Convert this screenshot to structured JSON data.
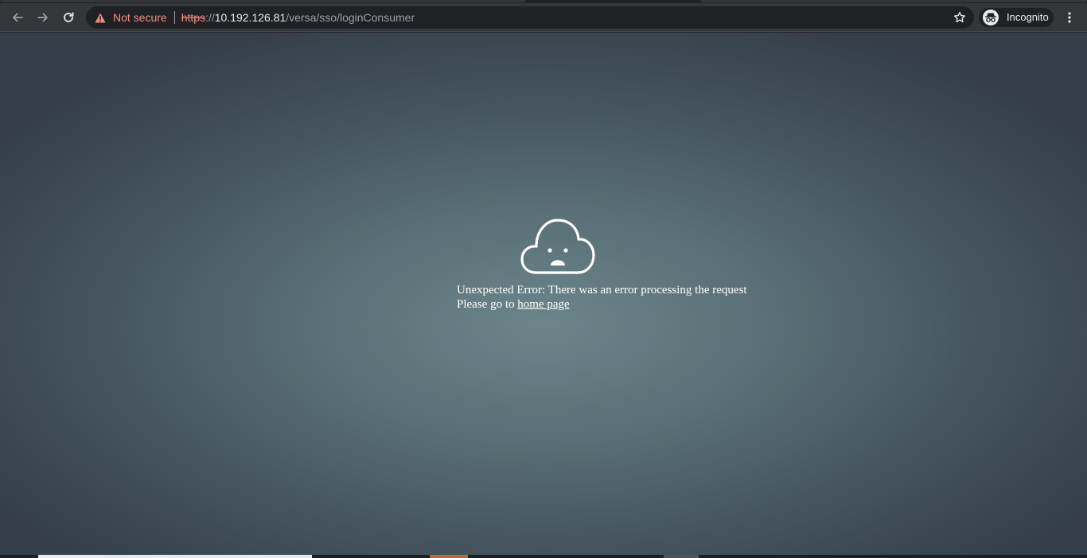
{
  "browser": {
    "security_label": "Not secure",
    "url_scheme": "https",
    "url_separator": "://",
    "url_host": "10.192.126.81",
    "url_path": "/versa/sso/loginConsumer",
    "profile_label": "Incognito",
    "icons": {
      "back": "arrow-left-icon",
      "forward": "arrow-right-icon",
      "reload": "reload-icon",
      "warning": "warning-triangle-icon",
      "bookmark": "star-icon",
      "incognito": "incognito-icon",
      "menu": "kebab-menu-icon"
    },
    "colors": {
      "insecure": "#f28b82",
      "toolbar": "#35363a",
      "omnibox": "#202124"
    }
  },
  "page": {
    "error_icon": "sad-cloud-icon",
    "error_message": "Unexpected Error: There was an error processing the request",
    "redirect_prefix": "Please go to ",
    "home_link_text": "home page",
    "background_center": "#6b858b",
    "background_edge": "#343f4b"
  }
}
